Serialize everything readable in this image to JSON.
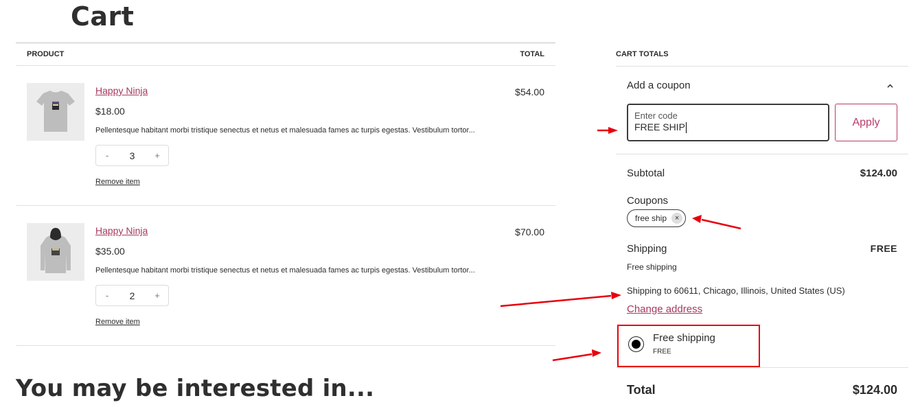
{
  "page": {
    "title": "Cart"
  },
  "cart": {
    "headers": {
      "product": "PRODUCT",
      "total": "TOTAL"
    },
    "items": [
      {
        "name": "Happy Ninja",
        "image": "tshirt-image",
        "price": "$18.00",
        "description": "Pellentesque habitant morbi tristique senectus et netus et malesuada fames ac turpis egestas. Vestibulum tortor...",
        "quantity": "3",
        "decrement": "-",
        "increment": "+",
        "remove_label": "Remove item",
        "line_total": "$54.00"
      },
      {
        "name": "Happy Ninja",
        "image": "hoodie-image",
        "price": "$35.00",
        "description": "Pellentesque habitant morbi tristique senectus et netus et malesuada fames ac turpis egestas. Vestibulum tortor...",
        "quantity": "2",
        "decrement": "-",
        "increment": "+",
        "remove_label": "Remove item",
        "line_total": "$70.00"
      }
    ]
  },
  "interested": {
    "heading": "You may be interested in..."
  },
  "totals": {
    "heading": "CART TOTALS",
    "coupon": {
      "toggle_label": "Add a coupon",
      "input_label": "Enter code",
      "input_value": "FREE SHIP",
      "apply_label": "Apply"
    },
    "subtotal": {
      "label": "Subtotal",
      "value": "$124.00"
    },
    "coupons": {
      "label": "Coupons",
      "applied": "free ship",
      "remove_glyph": "×"
    },
    "shipping": {
      "label": "Shipping",
      "value": "FREE",
      "method": "Free shipping",
      "destination": "Shipping to 60611, Chicago, Illinois, United States (US)",
      "change_address": "Change address",
      "option": {
        "label": "Free shipping",
        "price": "FREE",
        "selected": true
      }
    },
    "total": {
      "label": "Total",
      "value": "$124.00"
    }
  },
  "colors": {
    "accent": "#a7385f",
    "annotation": "#e8000b"
  }
}
